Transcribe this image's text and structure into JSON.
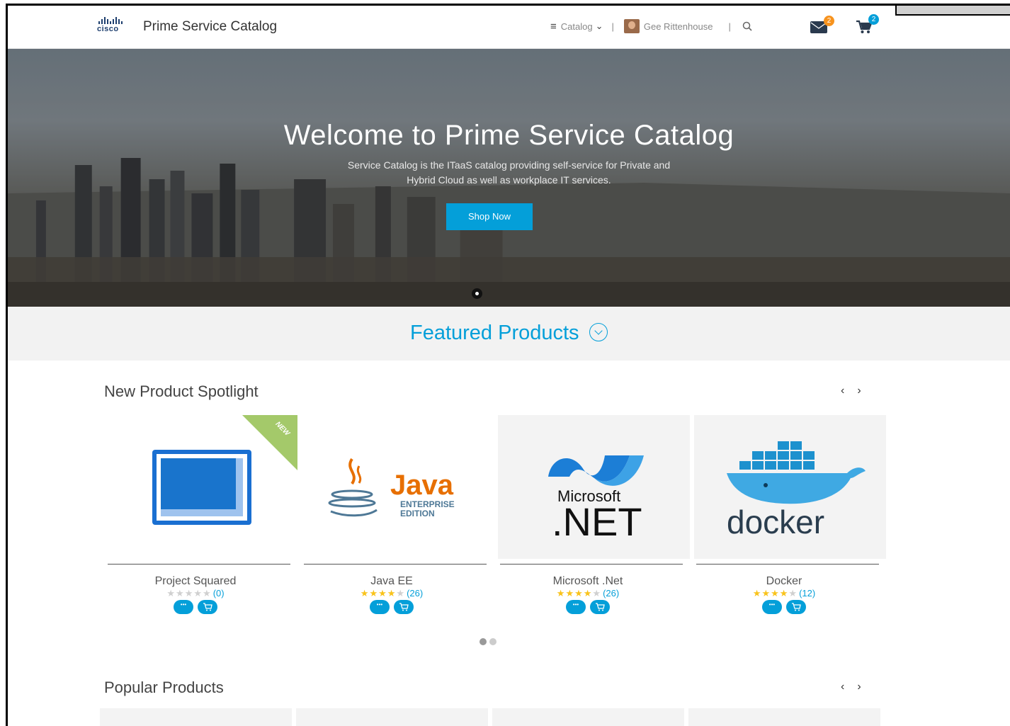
{
  "header": {
    "logo_text": "cisco",
    "app_title": "Prime Service Catalog",
    "catalog_label": "Catalog",
    "user_name": "Gee Rittenhouse",
    "mail_count": "2",
    "cart_count": "2"
  },
  "hero": {
    "title": "Welcome to Prime Service Catalog",
    "subtitle_line1": "Service Catalog is the ITaaS catalog providing self-service for Private and",
    "subtitle_line2": "Hybrid Cloud as well as workplace IT services.",
    "cta_label": "Shop Now"
  },
  "featured": {
    "title": "Featured Products"
  },
  "spotlight": {
    "title": "New Product Spotlight",
    "prev": "‹",
    "next": "›",
    "new_ribbon": "NEW",
    "products": [
      {
        "name": "Project Squared",
        "stars": 0,
        "count": "(0)"
      },
      {
        "name": "Java EE",
        "stars": 4,
        "count": "(26)",
        "logo_word": "Java",
        "logo_sub1": "ENTERPRISE",
        "logo_sub2": "EDITION"
      },
      {
        "name": "Microsoft .Net",
        "stars": 4,
        "count": "(26)",
        "logo_word": "Microsoft",
        "logo_big": ".NET"
      },
      {
        "name": "Docker",
        "stars": 4,
        "count": "(12)",
        "logo_word": "docker"
      }
    ]
  },
  "popular": {
    "title": "Popular Products",
    "prev": "‹",
    "next": "›"
  },
  "colors": {
    "accent": "#049fd9",
    "star": "#f9c31b",
    "badge_mail": "#f7931e",
    "badge_cart": "#049fd9",
    "ribbon": "#a4c96a"
  }
}
